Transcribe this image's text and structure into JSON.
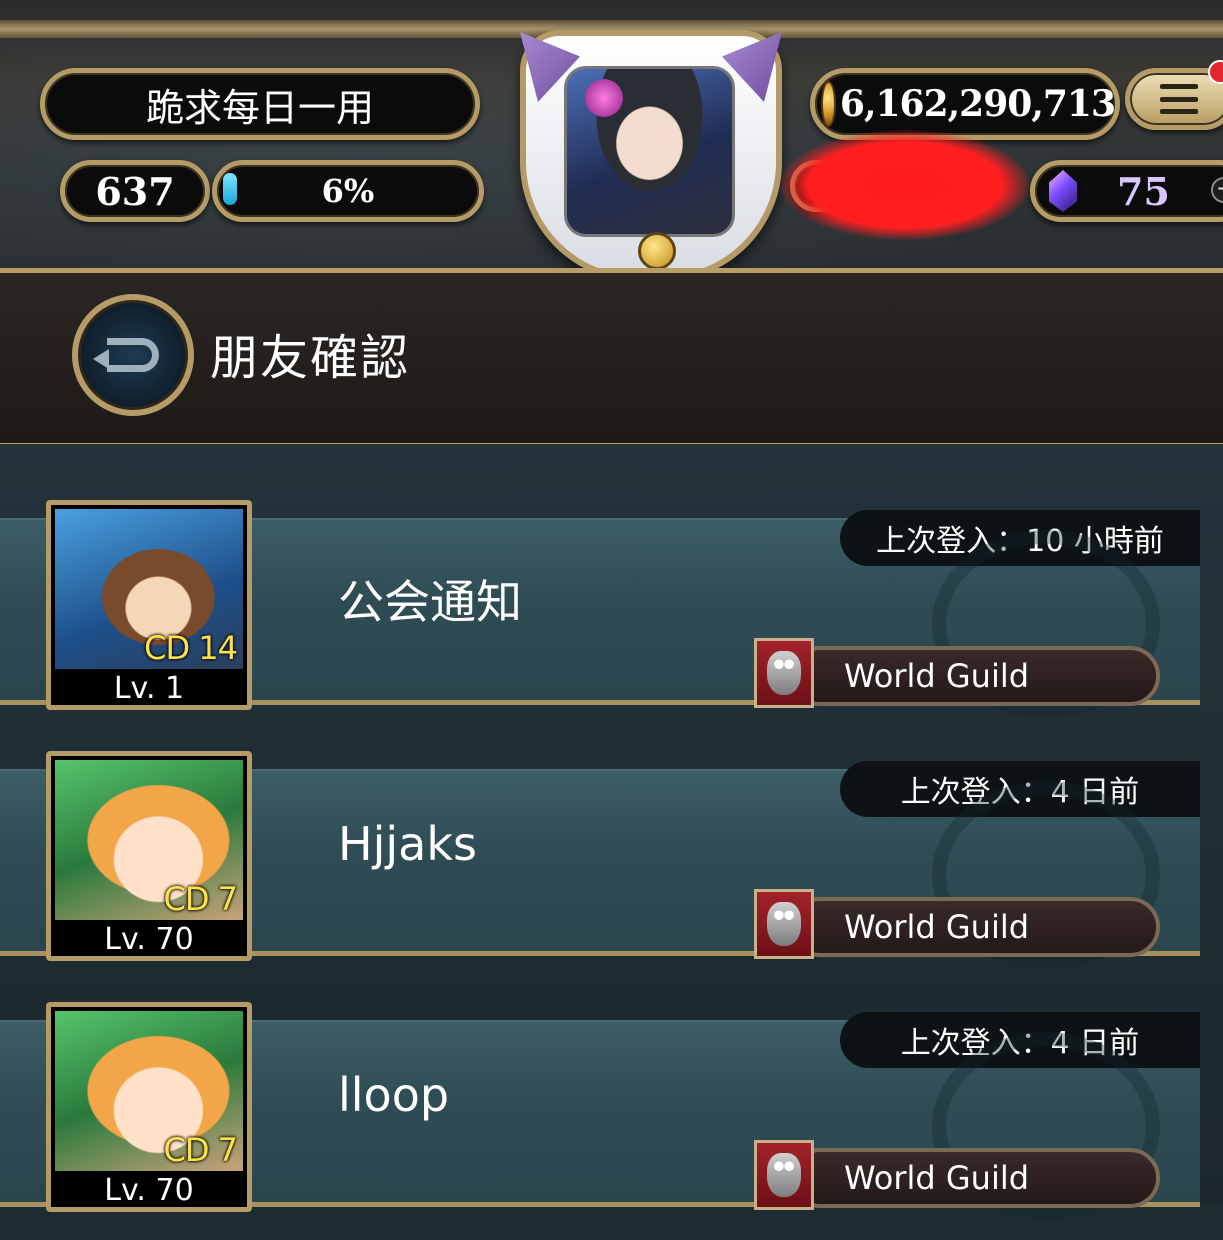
{
  "header": {
    "player_name": "跪求每日一用",
    "level": "637",
    "exp_percent_label": "6%",
    "exp_progress": 0.06,
    "gold": "6,162,290,713",
    "crystals": "75",
    "icons": {
      "menu": "hamburger-menu-icon",
      "coin": "gold-coin-icon",
      "crystal": "crystal-icon",
      "plus": "plus-icon",
      "back": "back-arrow-icon"
    }
  },
  "page": {
    "title": "朋友確認"
  },
  "friends": [
    {
      "name": "公会通知",
      "last_login": "上次登入：10 小時前",
      "cd": "CD 14",
      "level": "Lv. 1",
      "guild": "World Guild",
      "portrait": "blue"
    },
    {
      "name": "Hjjaks",
      "last_login": "上次登入：4 日前",
      "cd": "CD 7",
      "level": "Lv. 70",
      "guild": "World Guild",
      "portrait": "green"
    },
    {
      "name": "lloop",
      "last_login": "上次登入：4 日前",
      "cd": "CD 7",
      "level": "Lv. 70",
      "guild": "World Guild",
      "portrait": "green"
    }
  ]
}
